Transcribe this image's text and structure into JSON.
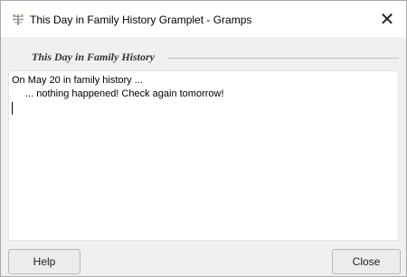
{
  "window": {
    "title": "This Day in Family History Gramplet - Gramps",
    "close_symbol": "✕",
    "app_icon": "gramps-tree-icon"
  },
  "gramplet": {
    "section_title": "This Day in Family History",
    "line1": "On May 20 in family history ...",
    "line2": "... nothing happened!  Check again tomorrow!"
  },
  "buttons": {
    "help_label": "Help",
    "close_label": "Close"
  },
  "colors": {
    "window_bg": "#f0f0f0",
    "text_bg": "#ffffff",
    "title_bar_bg": "#ffffff"
  }
}
